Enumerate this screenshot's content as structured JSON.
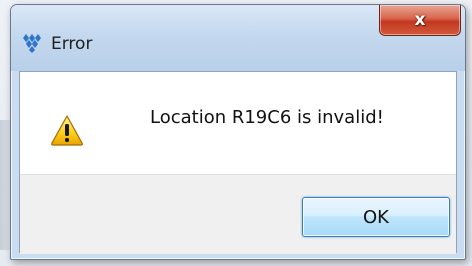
{
  "dialog": {
    "title": "Error",
    "message": "Location R19C6 is invalid!",
    "close_label": "x",
    "ok_label": "OK",
    "icon": "warning-triangle"
  },
  "colors": {
    "titlebar": "#c4d8ee",
    "close_button": "#c2381f",
    "ok_border": "#3c7fb1",
    "button_bar": "#f0f0f0"
  }
}
